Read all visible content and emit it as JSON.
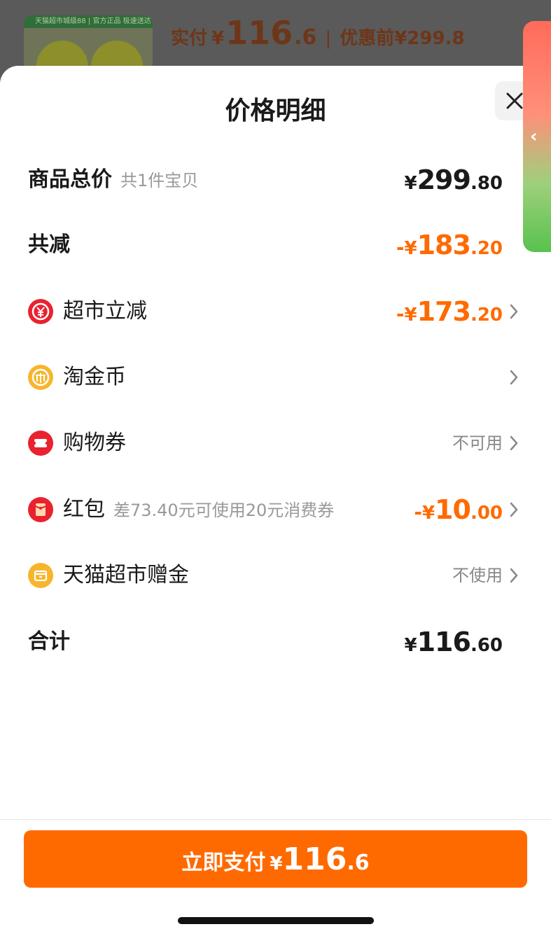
{
  "background": {
    "thumb_strip_text": "天猫超市城级88 | 官方正品 极速送达",
    "paid_label": "实付",
    "paid_currency": "¥",
    "paid_int": "116",
    "paid_dec": ".6",
    "separator": "|",
    "before_label": "优惠前",
    "before_value": "¥299.8"
  },
  "sheet": {
    "title": "价格明细"
  },
  "rows": [
    {
      "label": "商品总价",
      "sub": "共1件宝贝",
      "cur": "¥",
      "int": "299",
      "dec": ".80"
    },
    {
      "label": "共减",
      "sign": "-",
      "cur": "¥",
      "int": "183",
      "dec": ".20"
    },
    {
      "label": "超市立减",
      "icon": "yuan-coin-icon",
      "sign": "-",
      "cur": "¥",
      "int": "173",
      "dec": ".20"
    },
    {
      "label": "淘金币",
      "icon": "gold-coin-icon"
    },
    {
      "label": "购物券",
      "icon": "coupon-icon",
      "status": "不可用"
    },
    {
      "label": "红包",
      "icon": "red-envelope-icon",
      "sub": "差73.40元可使用20元消费券",
      "sign": "-",
      "cur": "¥",
      "int": "10",
      "dec": ".00"
    },
    {
      "label": "天猫超市赠金",
      "icon": "gift-wallet-icon",
      "status": "不使用"
    },
    {
      "label": "合计",
      "cur": "¥",
      "int": "116",
      "dec": ".60"
    }
  ],
  "pay_button": {
    "label": "立即支付",
    "cur": "¥",
    "int": "116",
    "dec": ".6"
  },
  "colors": {
    "accent": "#ff6a00",
    "icon_red": "#e8222f",
    "icon_yellow": "#f7b52c"
  }
}
